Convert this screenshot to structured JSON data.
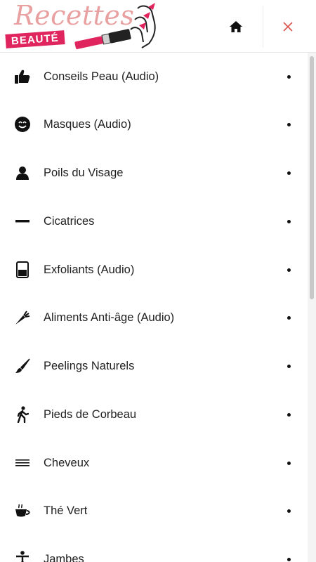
{
  "brand": {
    "script": "Recettes",
    "badge": "BEAUTÉ",
    "accent": "#e0245e",
    "script_color": "#e9a0a0"
  },
  "header": {
    "home_icon": "home-icon",
    "close_icon": "close-icon",
    "close_color": "#d9534f"
  },
  "menu": {
    "items": [
      {
        "label": "Conseils Peau (Audio)",
        "icon": "thumbs-up-icon"
      },
      {
        "label": "Masques (Audio)",
        "icon": "smile-face-icon"
      },
      {
        "label": "Poils du Visage",
        "icon": "person-icon"
      },
      {
        "label": "Cicatrices",
        "icon": "minus-icon"
      },
      {
        "label": "Exfoliants (Audio)",
        "icon": "jar-icon"
      },
      {
        "label": "Aliments Anti-âge (Audio)",
        "icon": "carrot-icon"
      },
      {
        "label": "Peelings Naturels",
        "icon": "paint-brush-icon"
      },
      {
        "label": "Pieds de Corbeau",
        "icon": "walking-icon"
      },
      {
        "label": "Cheveux",
        "icon": "lines-icon"
      },
      {
        "label": "Thé Vert",
        "icon": "tea-cup-icon"
      },
      {
        "label": "Jambes",
        "icon": "standing-person-icon"
      }
    ]
  }
}
